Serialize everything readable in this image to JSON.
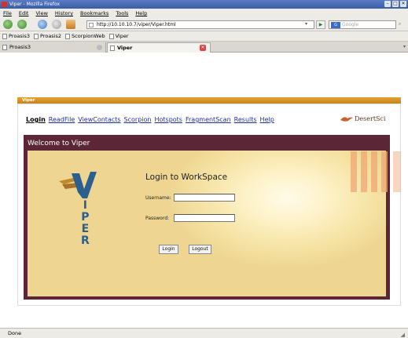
{
  "window": {
    "title": "Viper - Mozilla Firefox"
  },
  "menu": [
    {
      "label": "File"
    },
    {
      "label": "Edit"
    },
    {
      "label": "View"
    },
    {
      "label": "History"
    },
    {
      "label": "Bookmarks"
    },
    {
      "label": "Tools"
    },
    {
      "label": "Help"
    }
  ],
  "toolbar": {
    "url": "http://10.10.10.7/viper/Viper.html",
    "search_placeholder": "Google"
  },
  "bookmarks": [
    {
      "label": "Proasis3"
    },
    {
      "label": "Proasis2"
    },
    {
      "label": "ScorpionWeb"
    },
    {
      "label": "Viper"
    }
  ],
  "tabs": [
    {
      "label": "Proasis3"
    },
    {
      "label": "Viper"
    }
  ],
  "page": {
    "header_bar": "Viper",
    "nav": [
      "Login",
      "ReadFile",
      "ViewContacts",
      "Scorpion",
      "Hotspots",
      "FragmentScan",
      "Results",
      "Help"
    ],
    "brand": "DesertSci",
    "welcome": "Welcome to Viper",
    "logo_letters": [
      "I",
      "P",
      "E",
      "R"
    ],
    "login": {
      "title": "Login to WorkSpace",
      "username_label": "Username:",
      "password_label": "Password:",
      "login_button": "Login",
      "logout_button": "Logout"
    }
  },
  "status": {
    "text": "Done"
  },
  "colors": {
    "header_orange": "#d99326",
    "panel_dark": "#5b2736",
    "link_blue": "#1f2f9e"
  }
}
